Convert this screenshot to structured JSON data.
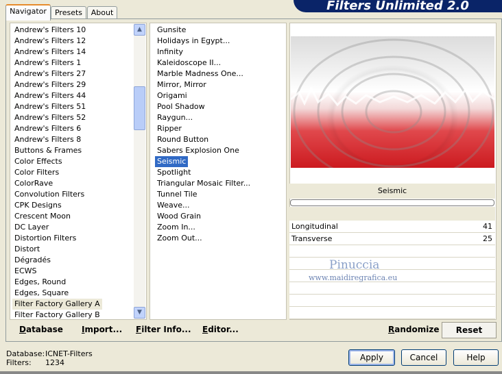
{
  "tabs": [
    "Navigator",
    "Presets",
    "About"
  ],
  "brand_title": "Filters Unlimited 2.0",
  "categories": [
    "Andrew's Filters 10",
    "Andrew's Filters 12",
    "Andrew's Filters 14",
    "Andrew's Filters 1",
    "Andrew's Filters 27",
    "Andrew's Filters 29",
    "Andrew's Filters 44",
    "Andrew's Filters 51",
    "Andrew's Filters 52",
    "Andrew's Filters 6",
    "Andrew's Filters 8",
    "Buttons & Frames",
    "Color Effects",
    "Color Filters",
    "ColorRave",
    "Convolution Filters",
    "CPK Designs",
    "Crescent Moon",
    "DC Layer",
    "Distortion Filters",
    "Distort",
    "Dégradés",
    "ECWS",
    "Edges, Round",
    "Edges, Square",
    "Filter Factory Gallery A",
    "Filter Factory Gallery B"
  ],
  "selected_category": "Filter Factory Gallery A",
  "filters": [
    "Gunsite",
    "Holidays in Egypt...",
    "Infinity",
    "Kaleidoscope II...",
    "Marble Madness One...",
    "Mirror, Mirror",
    "Origami",
    "Pool Shadow",
    "Raygun...",
    "Ripper",
    "Round Button",
    "Sabers Explosion One",
    "Seismic",
    "Spotlight",
    "Triangular Mosaic Filter...",
    "Tunnel Tile",
    "Weave...",
    "Wood Grain",
    "Zoom In...",
    "Zoom Out..."
  ],
  "selected_filter": "Seismic",
  "filter_name": "Seismic",
  "params": [
    {
      "label": "Longitudinal",
      "value": "41"
    },
    {
      "label": "Transverse",
      "value": "25"
    }
  ],
  "watermark": {
    "name": "Pinuccia",
    "url": "www.maidiregrafica.eu"
  },
  "buttons": {
    "database": "Database",
    "import": "Import...",
    "filter_info": "Filter Info...",
    "editor": "Editor...",
    "randomize": "Randomize",
    "reset": "Reset",
    "apply": "Apply",
    "cancel": "Cancel",
    "help": "Help"
  },
  "status": {
    "database_label": "Database:",
    "database_value": "ICNET-Filters",
    "filters_label": "Filters:",
    "filters_value": "1234"
  }
}
